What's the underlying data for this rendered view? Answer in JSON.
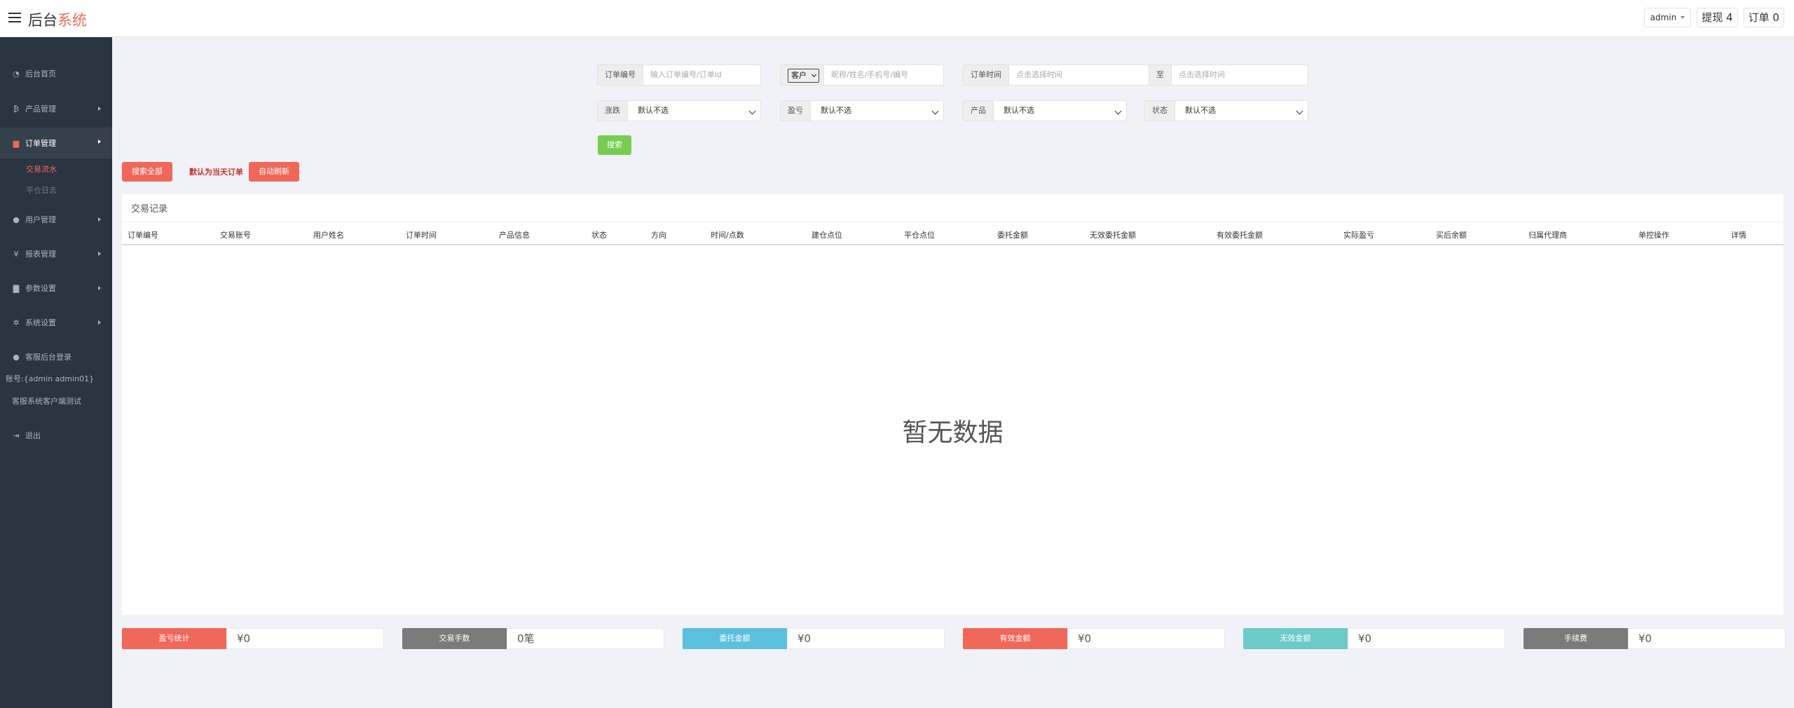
{
  "header": {
    "brand_main": "后台",
    "brand_accent": "系统",
    "admin_label": "admin",
    "withdraw_label": "提现 4",
    "orders_label": "订单 0"
  },
  "sidebar": {
    "items": [
      {
        "label": "后台首页",
        "icon": "dashboard-icon",
        "glyph": "◔"
      },
      {
        "label": "产品管理",
        "icon": "bitcoin-icon",
        "glyph": "₿"
      },
      {
        "label": "订单管理",
        "icon": "file-icon",
        "glyph": "▆"
      },
      {
        "label": "用户管理",
        "icon": "user-icon",
        "glyph": "●"
      },
      {
        "label": "报表管理",
        "icon": "yen-icon",
        "glyph": "¥"
      },
      {
        "label": "参数设置",
        "icon": "copy-icon",
        "glyph": "▇"
      },
      {
        "label": "系统设置",
        "icon": "cogs-icon",
        "glyph": "✲"
      },
      {
        "label": "客服后台登录",
        "icon": "user-icon",
        "glyph": "●"
      },
      {
        "label": "退出",
        "icon": "logout-icon",
        "glyph": "⇥"
      }
    ],
    "subitems": [
      "交易流水",
      "平仓日志"
    ],
    "account_text": "账号:{admin admin01}",
    "cs_test_text": "客服系统客户端测试"
  },
  "filters": {
    "order_no_label": "订单编号",
    "order_no_placeholder": "输入订单编号/订单id",
    "customer_select": "客户",
    "customer_placeholder": "昵称/姓名/手机号/编号",
    "order_time_label": "订单时间",
    "time_start_placeholder": "点击选择时间",
    "to_label": "至",
    "time_end_placeholder": "点击选择时间",
    "updown_label": "涨跌",
    "updown_value": "默认不选",
    "profit_label": "盈亏",
    "profit_value": "默认不选",
    "product_label": "产品",
    "product_value": "默认不选",
    "status_label": "状态",
    "status_value": "默认不选",
    "search_button": "搜索"
  },
  "actions": {
    "search_all": "搜索全部",
    "default_today": "默认为当天订单",
    "auto_refresh": "自动刷新"
  },
  "table": {
    "title": "交易记录",
    "columns": [
      "订单编号",
      "交易账号",
      "用户姓名",
      "订单时间",
      "产品信息",
      "状态",
      "方向",
      "时间/点数",
      "建仓点位",
      "平仓点位",
      "委托金额",
      "无效委托金额",
      "有效委托金额",
      "实际盈亏",
      "买后余额",
      "归属代理商",
      "单控操作",
      "详情"
    ],
    "empty_text": "暂无数据"
  },
  "stats": [
    {
      "label": "盈亏统计",
      "value": "¥0",
      "color": "#f0685a"
    },
    {
      "label": "交易手数",
      "value": "0笔",
      "color": "#7b7b7b"
    },
    {
      "label": "委托金额",
      "value": "¥0",
      "color": "#5bc0de"
    },
    {
      "label": "有效金额",
      "value": "¥0",
      "color": "#f0685a"
    },
    {
      "label": "无效金额",
      "value": "¥0",
      "color": "#6ccac9"
    },
    {
      "label": "手续费",
      "value": "¥0",
      "color": "#7b7b7b"
    }
  ]
}
